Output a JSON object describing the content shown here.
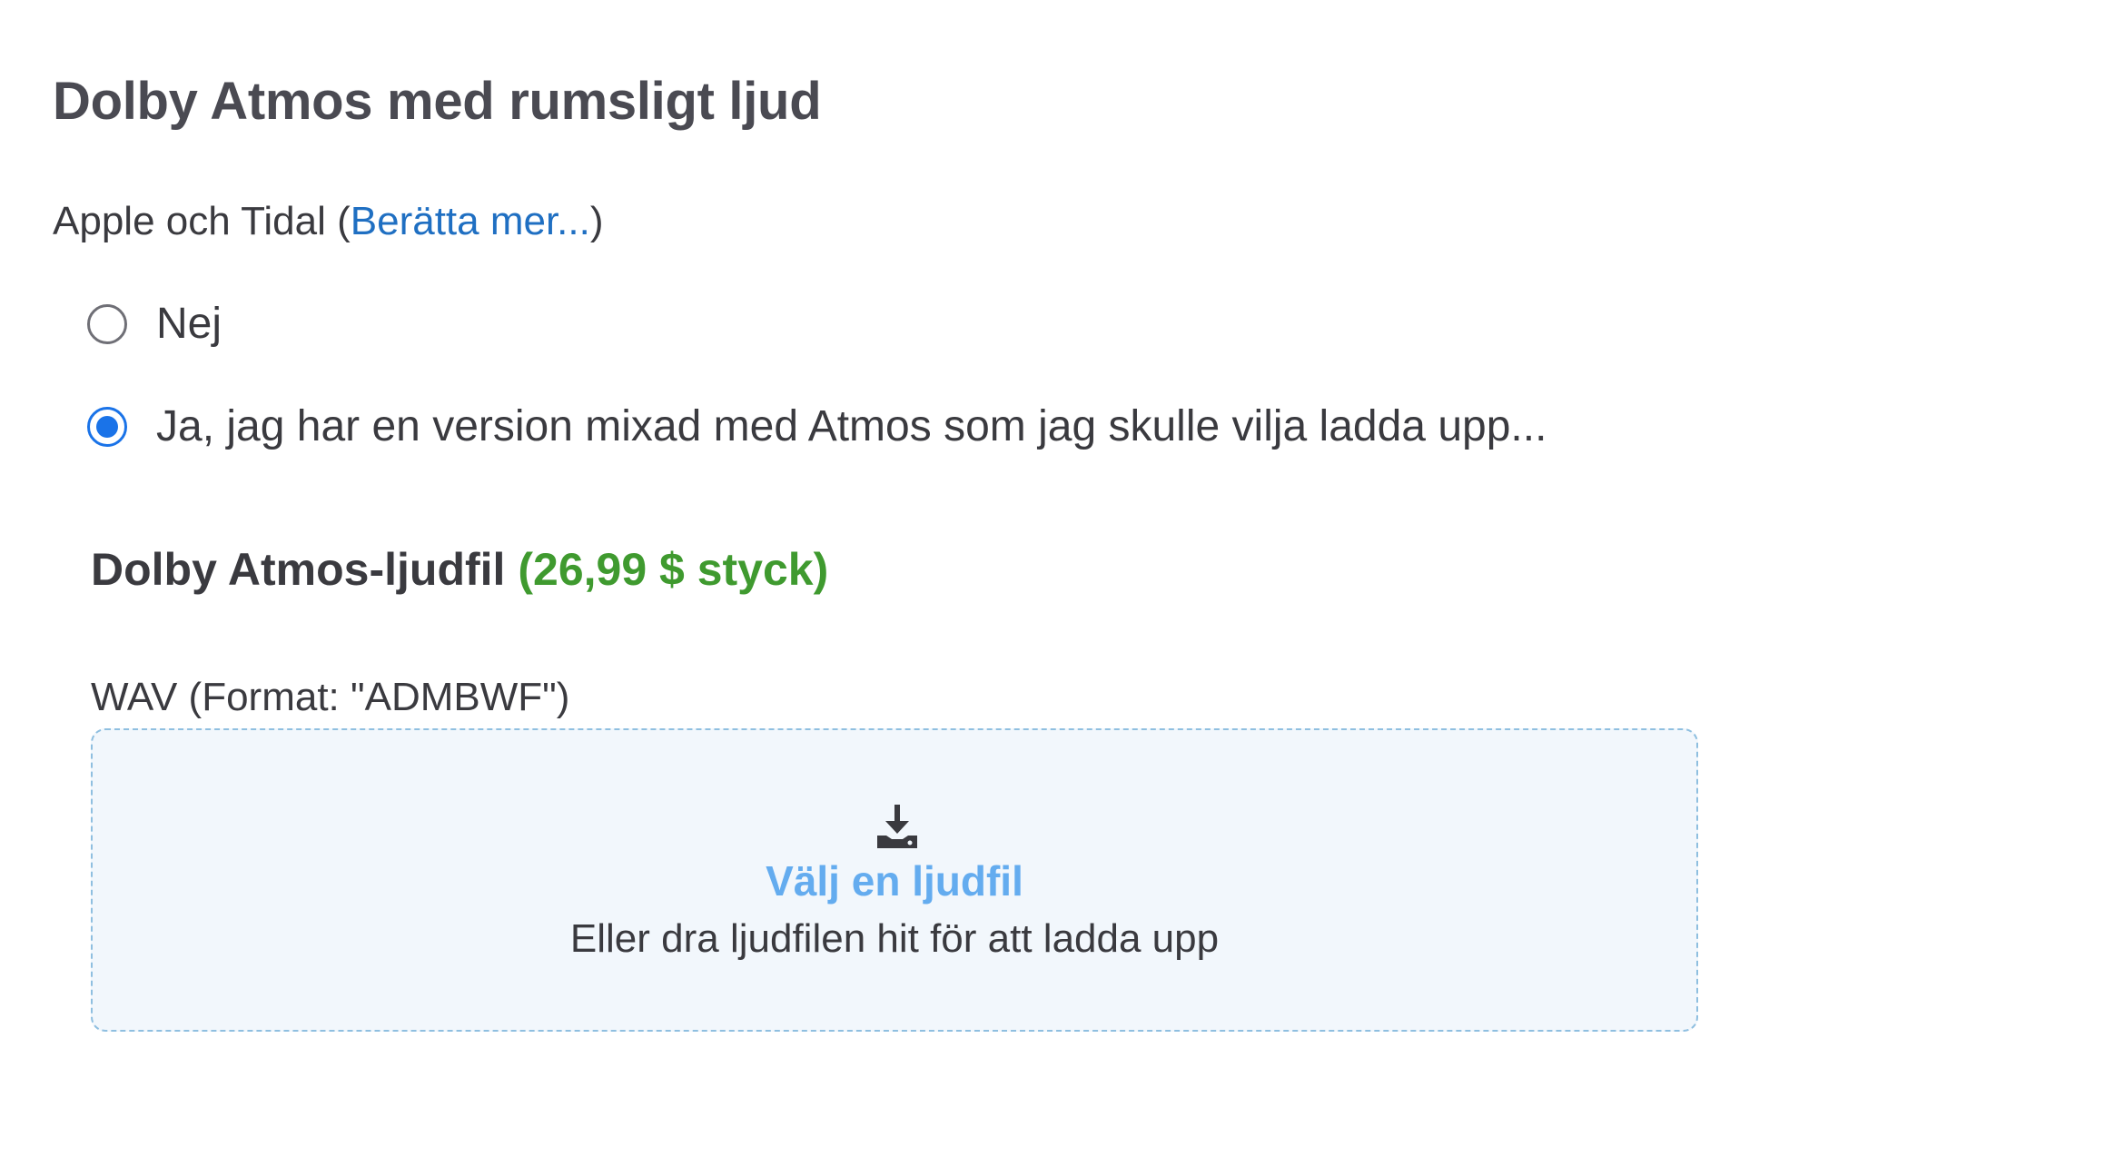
{
  "section": {
    "title": "Dolby Atmos med rumsligt ljud"
  },
  "platforms": {
    "prefix": "Apple och Tidal (",
    "link_label": "Berätta mer...",
    "suffix": ")"
  },
  "options": [
    {
      "label": "Nej",
      "selected": false
    },
    {
      "label": "Ja, jag har en version mixad med Atmos som jag skulle vilja ladda upp...",
      "selected": true
    }
  ],
  "product": {
    "name": "Dolby Atmos-ljudfil",
    "price": "(26,99 $ styck)"
  },
  "upload": {
    "format_label": "WAV (Format: \"ADMBWF\")",
    "icon": "download-icon",
    "choose_label": "Välj en ljudfil",
    "drop_hint": "Eller dra ljudfilen hit för att ladda upp"
  },
  "colors": {
    "accent": "#1a73e8",
    "link": "#1f6fc2",
    "price": "#3f9a2f",
    "upload_text": "#64acef",
    "dropzone_bg": "#f2f7fc"
  }
}
